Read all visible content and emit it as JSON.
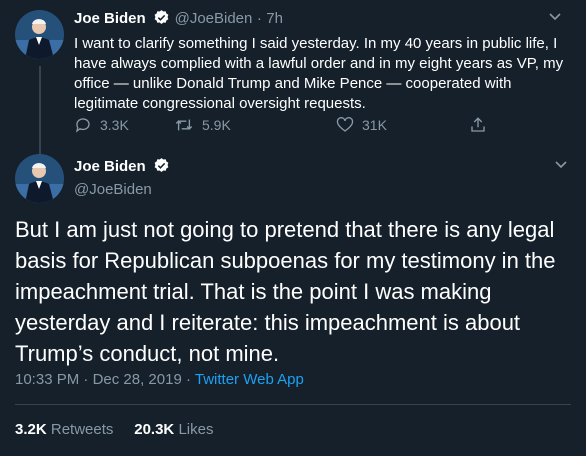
{
  "tweet1": {
    "name": "Joe Biden",
    "handle": "@JoeBiden",
    "separator": "·",
    "time": "7h",
    "text": "I want to clarify something I said yesterday. In my 40 years in public life, I have always complied with a lawful order and in my eight years as VP, my office — unlike Donald Trump and Mike Pence — cooperated with legitimate congressional oversight requests.",
    "replies": "3.3K",
    "retweets": "5.9K",
    "likes": "31K"
  },
  "tweet2": {
    "name": "Joe Biden",
    "handle": "@JoeBiden",
    "text": "But I am just not going to pretend that there is any legal basis for Republican subpoenas for my testimony in the impeachment trial. That is the point I was making yesterday and I reiterate: this impeachment is about Trump’s conduct, not mine.",
    "time": "10:33 PM",
    "separator1": "·",
    "date": "Dec 28, 2019",
    "separator2": "·",
    "source": "Twitter Web App",
    "retweet_count": "3.2K",
    "retweet_label": "Retweets",
    "like_count": "20.3K",
    "like_label": "Likes"
  },
  "icons": [
    "avatar-photo",
    "verified-icon",
    "chevron-down-icon",
    "reply-icon",
    "retweet-icon",
    "like-icon",
    "share-icon"
  ],
  "colors": {
    "background": "#15202b",
    "secondary_text": "#8899a6",
    "link": "#1da1f2",
    "divider": "#38444d"
  }
}
